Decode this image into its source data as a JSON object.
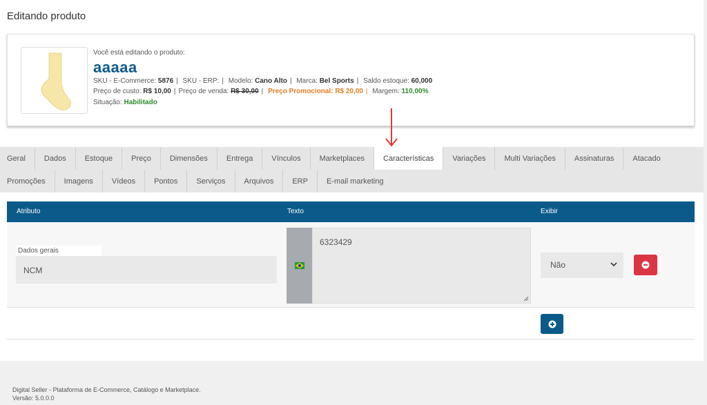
{
  "page": {
    "title": "Editando produto"
  },
  "product": {
    "editing_label": "Você está editando o produto:",
    "name": "aaaaa",
    "sku_ecommerce_label": "SKU - E-Commerce:",
    "sku_ecommerce_value": "5876",
    "sku_erp_label": "SKU - ERP:",
    "modelo_label": "Modelo:",
    "modelo_value": "Cano Alto",
    "marca_label": "Marca:",
    "marca_value": "Bel Sports",
    "saldo_label": "Saldo estoque:",
    "saldo_value": "60,000",
    "custo_label": "Preço de custo:",
    "custo_value": "R$ 10,00",
    "venda_label": "Preço de venda:",
    "venda_value": "R$ 30,00",
    "promo_label": "Preço Promocional:",
    "promo_value": "R$ 20,00",
    "margem_label": "Margem:",
    "margem_value": "110,00%",
    "situacao_label": "Situação:",
    "situacao_value": "Habilitado",
    "image_icon": "sock-image"
  },
  "tabs": {
    "row1": [
      "Geral",
      "Dados",
      "Estoque",
      "Preço",
      "Dimensões",
      "Entrega",
      "Vínculos",
      "Marketplaces",
      "Características",
      "Variações",
      "Multi Variações",
      "Assinaturas",
      "Atacado"
    ],
    "row2": [
      "Promoções",
      "Imagens",
      "Vídeos",
      "Pontos",
      "Serviços",
      "Arquivos",
      "ERP",
      "E-mail marketing"
    ],
    "active": "Características"
  },
  "table": {
    "headers": {
      "atributo": "Atributo",
      "texto": "Texto",
      "exibir": "Exibir"
    },
    "row": {
      "group_label": "Dados gerais",
      "attribute_value": "NCM",
      "language_icon": "brazil-flag-icon",
      "text_value": "6323429",
      "exibir_value": "Não"
    }
  },
  "footer": {
    "line1": "Digital Seller - Plataforma de E-Commerce, Catálogo e Marketplace.",
    "line2": "Versão: 5.0.0.0"
  },
  "colors": {
    "primary": "#0b5a8a",
    "danger": "#dc3545",
    "promo": "#e67e22",
    "success": "#2e8b2e",
    "arrow": "#e53935"
  }
}
